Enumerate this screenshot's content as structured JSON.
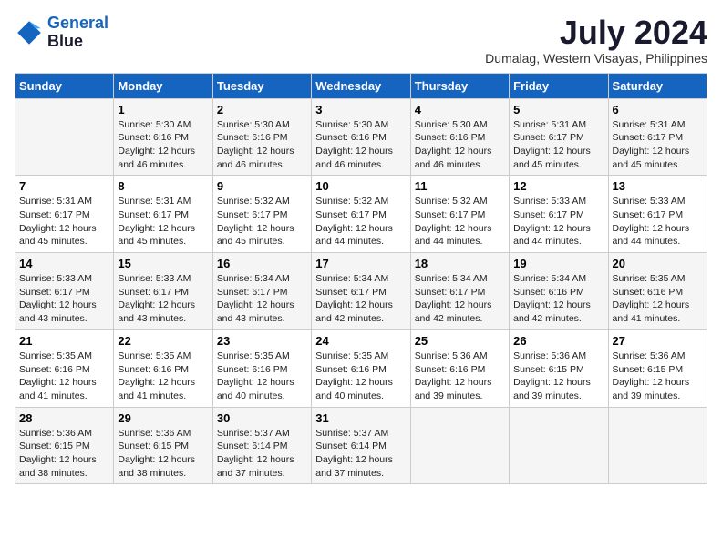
{
  "logo": {
    "line1": "General",
    "line2": "Blue"
  },
  "title": "July 2024",
  "location": "Dumalag, Western Visayas, Philippines",
  "headers": [
    "Sunday",
    "Monday",
    "Tuesday",
    "Wednesday",
    "Thursday",
    "Friday",
    "Saturday"
  ],
  "weeks": [
    [
      {
        "day": "",
        "sunrise": "",
        "sunset": "",
        "daylight": ""
      },
      {
        "day": "1",
        "sunrise": "Sunrise: 5:30 AM",
        "sunset": "Sunset: 6:16 PM",
        "daylight": "Daylight: 12 hours and 46 minutes."
      },
      {
        "day": "2",
        "sunrise": "Sunrise: 5:30 AM",
        "sunset": "Sunset: 6:16 PM",
        "daylight": "Daylight: 12 hours and 46 minutes."
      },
      {
        "day": "3",
        "sunrise": "Sunrise: 5:30 AM",
        "sunset": "Sunset: 6:16 PM",
        "daylight": "Daylight: 12 hours and 46 minutes."
      },
      {
        "day": "4",
        "sunrise": "Sunrise: 5:30 AM",
        "sunset": "Sunset: 6:16 PM",
        "daylight": "Daylight: 12 hours and 46 minutes."
      },
      {
        "day": "5",
        "sunrise": "Sunrise: 5:31 AM",
        "sunset": "Sunset: 6:17 PM",
        "daylight": "Daylight: 12 hours and 45 minutes."
      },
      {
        "day": "6",
        "sunrise": "Sunrise: 5:31 AM",
        "sunset": "Sunset: 6:17 PM",
        "daylight": "Daylight: 12 hours and 45 minutes."
      }
    ],
    [
      {
        "day": "7",
        "sunrise": "Sunrise: 5:31 AM",
        "sunset": "Sunset: 6:17 PM",
        "daylight": "Daylight: 12 hours and 45 minutes."
      },
      {
        "day": "8",
        "sunrise": "Sunrise: 5:31 AM",
        "sunset": "Sunset: 6:17 PM",
        "daylight": "Daylight: 12 hours and 45 minutes."
      },
      {
        "day": "9",
        "sunrise": "Sunrise: 5:32 AM",
        "sunset": "Sunset: 6:17 PM",
        "daylight": "Daylight: 12 hours and 45 minutes."
      },
      {
        "day": "10",
        "sunrise": "Sunrise: 5:32 AM",
        "sunset": "Sunset: 6:17 PM",
        "daylight": "Daylight: 12 hours and 44 minutes."
      },
      {
        "day": "11",
        "sunrise": "Sunrise: 5:32 AM",
        "sunset": "Sunset: 6:17 PM",
        "daylight": "Daylight: 12 hours and 44 minutes."
      },
      {
        "day": "12",
        "sunrise": "Sunrise: 5:33 AM",
        "sunset": "Sunset: 6:17 PM",
        "daylight": "Daylight: 12 hours and 44 minutes."
      },
      {
        "day": "13",
        "sunrise": "Sunrise: 5:33 AM",
        "sunset": "Sunset: 6:17 PM",
        "daylight": "Daylight: 12 hours and 44 minutes."
      }
    ],
    [
      {
        "day": "14",
        "sunrise": "Sunrise: 5:33 AM",
        "sunset": "Sunset: 6:17 PM",
        "daylight": "Daylight: 12 hours and 43 minutes."
      },
      {
        "day": "15",
        "sunrise": "Sunrise: 5:33 AM",
        "sunset": "Sunset: 6:17 PM",
        "daylight": "Daylight: 12 hours and 43 minutes."
      },
      {
        "day": "16",
        "sunrise": "Sunrise: 5:34 AM",
        "sunset": "Sunset: 6:17 PM",
        "daylight": "Daylight: 12 hours and 43 minutes."
      },
      {
        "day": "17",
        "sunrise": "Sunrise: 5:34 AM",
        "sunset": "Sunset: 6:17 PM",
        "daylight": "Daylight: 12 hours and 42 minutes."
      },
      {
        "day": "18",
        "sunrise": "Sunrise: 5:34 AM",
        "sunset": "Sunset: 6:17 PM",
        "daylight": "Daylight: 12 hours and 42 minutes."
      },
      {
        "day": "19",
        "sunrise": "Sunrise: 5:34 AM",
        "sunset": "Sunset: 6:16 PM",
        "daylight": "Daylight: 12 hours and 42 minutes."
      },
      {
        "day": "20",
        "sunrise": "Sunrise: 5:35 AM",
        "sunset": "Sunset: 6:16 PM",
        "daylight": "Daylight: 12 hours and 41 minutes."
      }
    ],
    [
      {
        "day": "21",
        "sunrise": "Sunrise: 5:35 AM",
        "sunset": "Sunset: 6:16 PM",
        "daylight": "Daylight: 12 hours and 41 minutes."
      },
      {
        "day": "22",
        "sunrise": "Sunrise: 5:35 AM",
        "sunset": "Sunset: 6:16 PM",
        "daylight": "Daylight: 12 hours and 41 minutes."
      },
      {
        "day": "23",
        "sunrise": "Sunrise: 5:35 AM",
        "sunset": "Sunset: 6:16 PM",
        "daylight": "Daylight: 12 hours and 40 minutes."
      },
      {
        "day": "24",
        "sunrise": "Sunrise: 5:35 AM",
        "sunset": "Sunset: 6:16 PM",
        "daylight": "Daylight: 12 hours and 40 minutes."
      },
      {
        "day": "25",
        "sunrise": "Sunrise: 5:36 AM",
        "sunset": "Sunset: 6:16 PM",
        "daylight": "Daylight: 12 hours and 39 minutes."
      },
      {
        "day": "26",
        "sunrise": "Sunrise: 5:36 AM",
        "sunset": "Sunset: 6:15 PM",
        "daylight": "Daylight: 12 hours and 39 minutes."
      },
      {
        "day": "27",
        "sunrise": "Sunrise: 5:36 AM",
        "sunset": "Sunset: 6:15 PM",
        "daylight": "Daylight: 12 hours and 39 minutes."
      }
    ],
    [
      {
        "day": "28",
        "sunrise": "Sunrise: 5:36 AM",
        "sunset": "Sunset: 6:15 PM",
        "daylight": "Daylight: 12 hours and 38 minutes."
      },
      {
        "day": "29",
        "sunrise": "Sunrise: 5:36 AM",
        "sunset": "Sunset: 6:15 PM",
        "daylight": "Daylight: 12 hours and 38 minutes."
      },
      {
        "day": "30",
        "sunrise": "Sunrise: 5:37 AM",
        "sunset": "Sunset: 6:14 PM",
        "daylight": "Daylight: 12 hours and 37 minutes."
      },
      {
        "day": "31",
        "sunrise": "Sunrise: 5:37 AM",
        "sunset": "Sunset: 6:14 PM",
        "daylight": "Daylight: 12 hours and 37 minutes."
      },
      {
        "day": "",
        "sunrise": "",
        "sunset": "",
        "daylight": ""
      },
      {
        "day": "",
        "sunrise": "",
        "sunset": "",
        "daylight": ""
      },
      {
        "day": "",
        "sunrise": "",
        "sunset": "",
        "daylight": ""
      }
    ]
  ]
}
